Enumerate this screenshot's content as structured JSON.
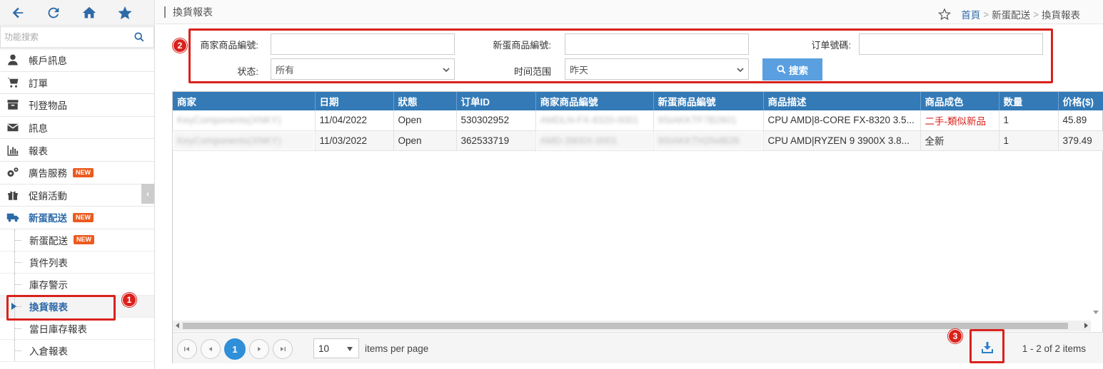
{
  "sidebar": {
    "search_placeholder": "功能搜索",
    "items": [
      {
        "label": "帳戶訊息"
      },
      {
        "label": "訂單"
      },
      {
        "label": "刊登物品"
      },
      {
        "label": "訊息"
      },
      {
        "label": "報表"
      },
      {
        "label": "廣告服務",
        "badge": "NEW"
      },
      {
        "label": "促銷活動"
      },
      {
        "label": "新蛋配送",
        "badge": "NEW"
      }
    ],
    "sub_items": [
      {
        "label": "新蛋配送",
        "badge": "NEW"
      },
      {
        "label": "貨件列表"
      },
      {
        "label": "庫存警示"
      },
      {
        "label": "換貨報表"
      },
      {
        "label": "當日庫存報表"
      },
      {
        "label": "入倉報表"
      }
    ]
  },
  "header": {
    "title": "換貨報表",
    "breadcrumb": {
      "home": "首頁",
      "sep": ">",
      "level1": "新蛋配送",
      "level2": "換貨報表"
    }
  },
  "filter": {
    "seller_sku_label": "商家商品編號:",
    "seller_sku_value": "",
    "newegg_item_label": "新蛋商品編號:",
    "newegg_item_value": "",
    "order_no_label": "订单號碼:",
    "order_no_value": "",
    "status_label": "状态:",
    "status_value": "所有",
    "time_label": "时间范围",
    "time_value": "昨天",
    "search_label": "搜索"
  },
  "annotations": {
    "one": "1",
    "two": "2",
    "three": "3"
  },
  "table": {
    "columns": [
      "商家",
      "日期",
      "狀態",
      "订单ID",
      "商家商品編號",
      "新蛋商品編號",
      "商品描述",
      "商品成色",
      "数量",
      "价格($)"
    ],
    "rows": [
      [
        "KeyComponents(XNKY)",
        "11/04/2022",
        "Open",
        "530302952",
        "AMDLN-FX-8320-0001",
        "9SIAKKTF7B2601",
        "CPU AMD|8-CORE FX-8320 3.5...",
        "二手-類似新品",
        "1",
        "45.89"
      ],
      [
        "KeyComponents(XNKY)",
        "11/03/2022",
        "Open",
        "362533719",
        "AMD-3900X-0001",
        "9SIAKKTH2N4B26",
        "CPU AMD|RYZEN 9 3900X 3.8...",
        "全新",
        "1",
        "379.49"
      ]
    ]
  },
  "pager": {
    "current_page": "1",
    "page_size": "10",
    "per_page_label": "items per page",
    "info": "1 - 2 of 2 items"
  },
  "colors": {
    "accent": "#337ab7",
    "annotation": "#d9221c",
    "badge": "#ec5a1e"
  }
}
